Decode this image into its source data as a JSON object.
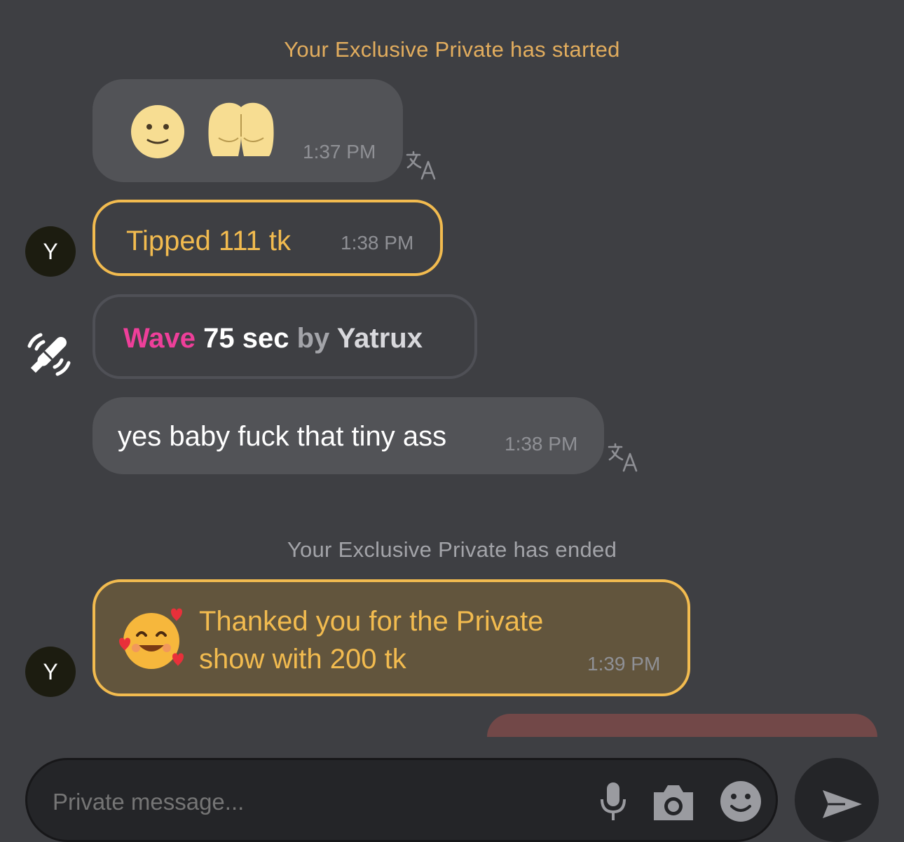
{
  "chat": {
    "system_started": "Your Exclusive Private has started",
    "emoji_message": {
      "time": "1:37 PM"
    },
    "tip": {
      "avatar": "Y",
      "label": "Tipped 111 tk",
      "time": "1:38 PM"
    },
    "toy": {
      "pattern": "Wave",
      "duration": "75 sec",
      "by": "by",
      "user": "Yatrux"
    },
    "text_message": {
      "text": "yes baby fuck that tiny ass",
      "time": "1:38 PM"
    },
    "system_ended": "Your Exclusive Private has ended",
    "thanks": {
      "avatar": "Y",
      "line1": "Thanked you for the Private",
      "line2": "show with 200 tk",
      "time": "1:39 PM"
    }
  },
  "composer": {
    "placeholder": "Private message..."
  },
  "colors": {
    "background": "#3e3f43",
    "accent_gold": "#f2bb4f",
    "system_text_gold": "#e2ad5e",
    "system_text_gray": "#a3a4a9",
    "toy_pink": "#ee3f9a",
    "bubble_gray": "#525357",
    "thanks_bg": "#62553d",
    "outgoing_bubble": "#724848"
  },
  "icons": [
    "slightly-smiling-face-icon",
    "peach-bottom-icon",
    "translate-icon",
    "vibrator-toy-icon",
    "smiling-face-with-hearts-icon",
    "microphone-icon",
    "camera-icon",
    "emoji-icon",
    "send-icon"
  ]
}
